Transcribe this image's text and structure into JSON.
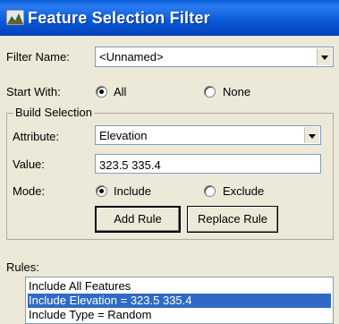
{
  "window": {
    "title": "Feature Selection Filter"
  },
  "filter": {
    "label": "Filter Name:",
    "value": "<Unnamed>"
  },
  "start_with": {
    "label": "Start With:",
    "option_all": "All",
    "option_none": "None",
    "selected": "All"
  },
  "build": {
    "title": "Build Selection",
    "attribute_label": "Attribute:",
    "attribute_value": "Elevation",
    "value_label": "Value:",
    "value_value": "323.5 335.4",
    "mode_label": "Mode:",
    "mode_include": "Include",
    "mode_exclude": "Exclude",
    "mode_selected": "Include",
    "add_rule": "Add Rule",
    "replace_rule": "Replace Rule"
  },
  "rules": {
    "label": "Rules:",
    "items": [
      "Include All Features",
      "Include Elevation = 323.5 335.4",
      "Include Type = Random"
    ],
    "selected_index": 1
  },
  "colors": {
    "title_bar": "#0a5fd8",
    "selection": "#316ac5",
    "background": "#ece9d8"
  }
}
